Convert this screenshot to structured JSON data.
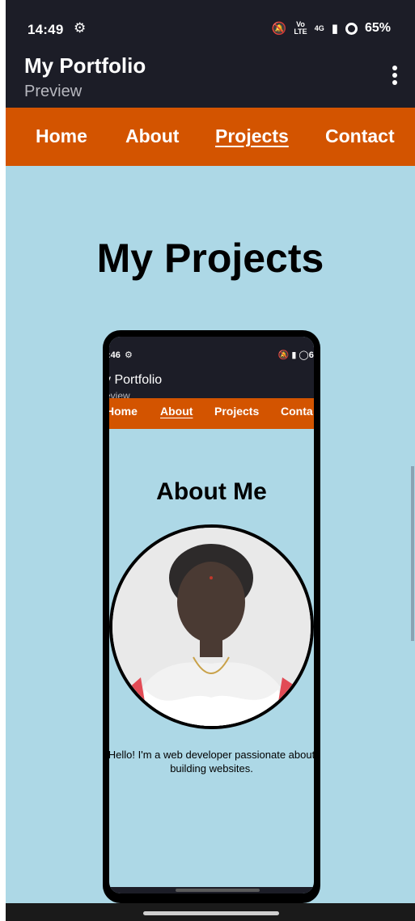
{
  "status_bar": {
    "time": "14:49",
    "network_badge_top": "Vo",
    "network_badge_bottom": "LTE",
    "network_type": "4G",
    "battery": "65%"
  },
  "app_bar": {
    "title": "My Portfolio",
    "subtitle": "Preview"
  },
  "nav": {
    "items": [
      "Home",
      "About",
      "Projects",
      "Contact"
    ],
    "active": "Projects"
  },
  "page": {
    "heading": "My Projects"
  },
  "project_preview": {
    "status_time": ":46",
    "status_right": "66",
    "title": "y Portfolio",
    "subtitle": "eview",
    "nav": [
      "Home",
      "About",
      "Projects",
      "Conta"
    ],
    "active_nav": "About",
    "heading": "About Me",
    "text_line1": "Hello! I'm a web developer passionate about",
    "text_line2": "building websites."
  }
}
